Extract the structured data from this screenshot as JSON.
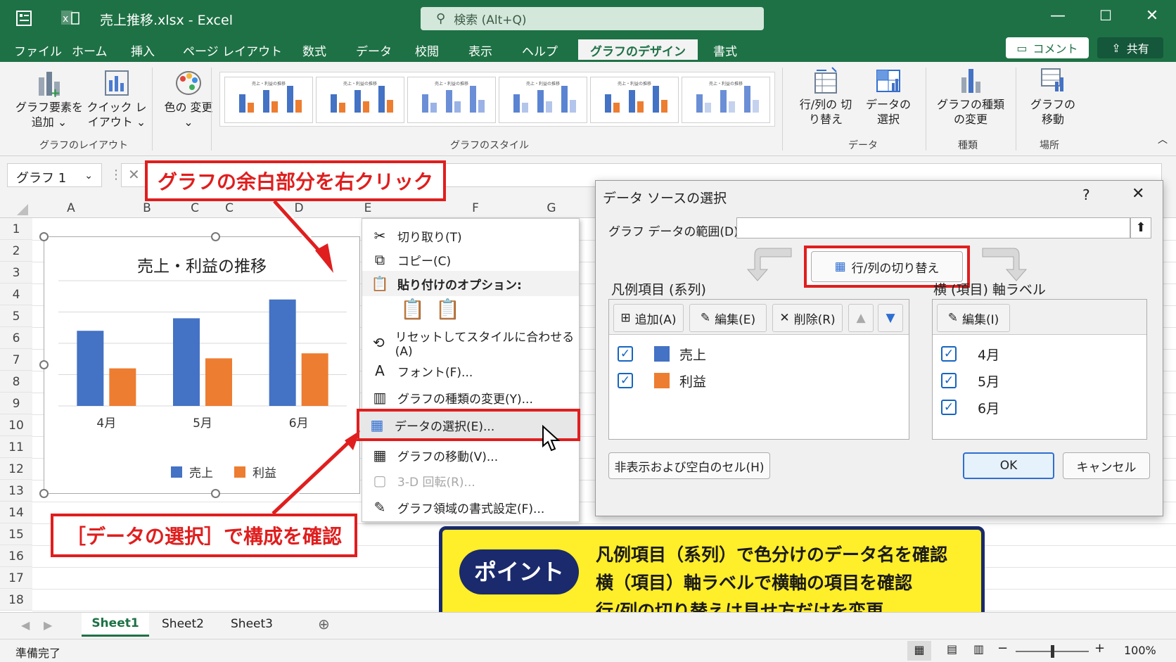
{
  "window": {
    "title": "売上推移.xlsx  -  Excel",
    "search_placeholder": "検索 (Alt+Q)"
  },
  "menu": {
    "tabs": [
      "ファイル",
      "ホーム",
      "挿入",
      "ページ レイアウト",
      "数式",
      "データ",
      "校閲",
      "表示",
      "ヘルプ",
      "グラフのデザイン",
      "書式"
    ],
    "comment_label": "コメント",
    "share_label": "共有"
  },
  "ribbon": {
    "add_element": "グラフ要素を追加 ⌄",
    "quick_layout": "クイック レイアウト ⌄",
    "change_colors": "色の 変更 ⌄",
    "group_layout": "グラフのレイアウト",
    "group_styles": "グラフのスタイル",
    "switch_row_col": "行/列の 切り替え",
    "select_data": "データの 選択",
    "group_data": "データ",
    "change_type": "グラフの種類 の変更",
    "group_type": "種類",
    "move_chart": "グラフの 移動",
    "group_location": "場所",
    "thumb_titles": [
      "売上・利益の推移",
      "売上・利益の推移",
      "売上・利益の推移",
      "売上・利益の推移",
      "売上・利益の推移",
      "売上・利益の推移"
    ]
  },
  "namebox": {
    "value": "グラフ 1"
  },
  "columns": [
    "A",
    "B",
    "C",
    "C",
    "D",
    "E",
    "F",
    "G"
  ],
  "rows": [
    "1",
    "2",
    "3",
    "4",
    "5",
    "6",
    "7",
    "8",
    "9",
    "10",
    "11",
    "12",
    "13",
    "14",
    "15",
    "16",
    "17",
    "18"
  ],
  "chart_data": {
    "type": "bar",
    "title": "売上・利益の推移",
    "categories": [
      "4月",
      "5月",
      "6月"
    ],
    "series": [
      {
        "name": "売上",
        "values": [
          60,
          70,
          85
        ],
        "color": "#4472c4"
      },
      {
        "name": "利益",
        "values": [
          30,
          38,
          42
        ],
        "color": "#ed7d31"
      }
    ],
    "ylim": [
      0,
      100
    ],
    "legend": "bottom"
  },
  "context_menu": {
    "cut": "切り取り(T)",
    "copy": "コピー(C)",
    "paste_options": "貼り付けのオプション:",
    "reset_style": "リセットしてスタイルに合わせる(A)",
    "font": "フォント(F)...",
    "change_type": "グラフの種類の変更(Y)...",
    "select_data": "データの選択(E)...",
    "move_chart": "グラフの移動(V)...",
    "rotate_3d": "3-D 回転(R)...",
    "format_area": "グラフ領域の書式設定(F)..."
  },
  "dialog": {
    "title": "データ ソースの選択",
    "help": "?",
    "close": "✕",
    "range_label": "グラフ データの範囲(D):",
    "range_value": "",
    "switch_button": "行/列の切り替え",
    "legend_header": "凡例項目 (系列)",
    "axis_header": "横 (項目) 軸ラベル",
    "add": "追加(A)",
    "edit": "編集(E)",
    "delete": "削除(R)",
    "axis_edit": "編集(I)",
    "series": [
      {
        "name": "売上",
        "color": "#4472c4"
      },
      {
        "name": "利益",
        "color": "#ed7d31"
      }
    ],
    "axis_items": [
      "4月",
      "5月",
      "6月"
    ],
    "hidden_cells": "非表示および空白のセル(H)",
    "ok": "OK",
    "cancel": "キャンセル"
  },
  "callouts": {
    "right_click": "グラフの余白部分を右クリック",
    "select_data": "［データの選択］で構成を確認"
  },
  "point": {
    "badge": "ポイント",
    "lines": [
      "凡例項目（系列）で色分けのデータ名を確認",
      "横（項目）軸ラベルで横軸の項目を確認",
      "行/列の切り替えは見せ方だけを変更"
    ]
  },
  "sheets": {
    "tabs": [
      "Sheet1",
      "Sheet2",
      "Sheet3"
    ],
    "active": "Sheet1"
  },
  "status": {
    "ready": "準備完了",
    "zoom": "100%"
  }
}
